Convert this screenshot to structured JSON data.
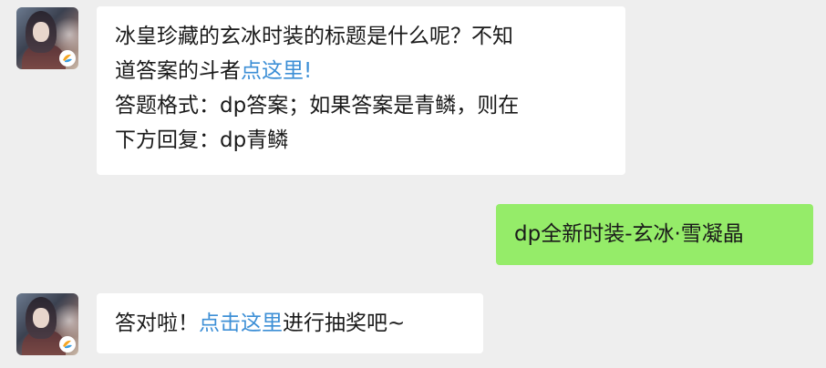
{
  "messages": [
    {
      "sender": "bot",
      "avatar_icon": "character-avatar-icon",
      "line1": "冰皇珍藏的玄冰时装的标题是什么呢？不知",
      "line2_text": "道答案的斗者",
      "line2_link": "点这里!",
      "line3": "答题格式：dp答案；如果答案是青鳞，则在",
      "line4": "下方回复：dp青鳞"
    },
    {
      "sender": "user",
      "text": "dp全新时装-玄冰·雪凝晶"
    },
    {
      "sender": "bot",
      "avatar_icon": "character-avatar-icon",
      "text_before": "答对啦！",
      "link": "点击这里",
      "text_after": "进行抽奖吧~"
    }
  ],
  "colors": {
    "background": "#eeeeee",
    "bot_bubble": "#ffffff",
    "user_bubble": "#95ec69",
    "link": "#3d8fd6"
  }
}
